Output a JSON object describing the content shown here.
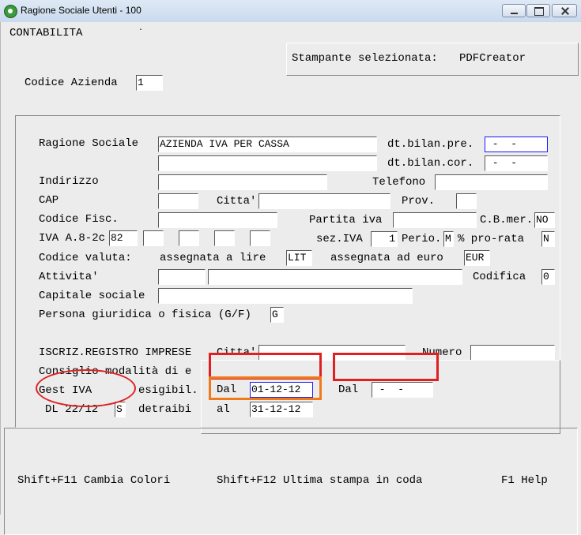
{
  "window": {
    "title": "Ragione Sociale Utenti - 100"
  },
  "header": {
    "module": "CONTABILITA",
    "dot": ".",
    "printer_label": "Stampante selezionata:",
    "printer_value": "PDFCreator"
  },
  "company": {
    "label": "Codice Azienda",
    "value": "1"
  },
  "form": {
    "ragione_sociale": {
      "label": "Ragione Sociale",
      "value": "AZIENDA IVA PER CASSA",
      "value2": ""
    },
    "dt_bilan_pre": {
      "label": "dt.bilan.pre.",
      "value": " -  -"
    },
    "dt_bilan_cor": {
      "label": "dt.bilan.cor.",
      "value": " -  -"
    },
    "indirizzo": {
      "label": "Indirizzo",
      "value": ""
    },
    "telefono": {
      "label": "Telefono",
      "value": ""
    },
    "cap": {
      "label": "CAP",
      "value": ""
    },
    "citta": {
      "label": "Citta'",
      "value": ""
    },
    "prov": {
      "label": "Prov.",
      "value": ""
    },
    "codice_fisc": {
      "label": "Codice Fisc.",
      "value": ""
    },
    "partita_iva": {
      "label": "Partita iva",
      "value": ""
    },
    "cb_mer": {
      "label": "C.B.mer.",
      "value": "NO"
    },
    "iva_a8": {
      "label": "IVA A.8-2c",
      "values": [
        "82",
        "",
        "",
        "",
        ""
      ]
    },
    "sez_iva": {
      "label": "sez.IVA",
      "value": "1"
    },
    "perio": {
      "label": "Perio.",
      "value": "M"
    },
    "pro_rata": {
      "label": "% pro-rata",
      "value": "N"
    },
    "codice_valuta": {
      "label": "Codice valuta:",
      "lire_label": "assegnata a lire",
      "lire_value": "LIT",
      "euro_label": "assegnata ad euro",
      "euro_value": "EUR"
    },
    "attivita": {
      "label": "Attivita'",
      "value1": "",
      "value2": ""
    },
    "codifica": {
      "label": "Codifica",
      "value": "0"
    },
    "capitale": {
      "label": "Capitale sociale",
      "value": ""
    },
    "persona": {
      "label": "Persona giuridica o fisica (G/F)",
      "value": "G"
    },
    "iscriz": {
      "label": "ISCRIZ.REGISTRO IMPRESE",
      "citta_label": "Citta'",
      "citta_value": "",
      "numero_label": "Numero",
      "numero_value": ""
    },
    "consiglio": {
      "label": "Consiglio modalità di e"
    },
    "gest_iva": {
      "label": "Gest IVA",
      "esigibil": "esigibil."
    },
    "dl": {
      "label": "DL 22/12",
      "value": "S",
      "detraibil": "detraibi"
    }
  },
  "popup": {
    "dal_label": "Dal",
    "dal_value": "01-12-12",
    "al_label": "al",
    "al_value": "31-12-12",
    "dal2_label": "Dal",
    "dal2_value": " -  -"
  },
  "footer": {
    "f11": "Shift+F11 Cambia Colori",
    "f12": "Shift+F12 Ultima stampa in coda",
    "f1": "F1 Help"
  },
  "colors": {
    "annotation_red": "#e02020",
    "annotation_orange": "#f07a1a",
    "focus": "#1a1aff"
  }
}
